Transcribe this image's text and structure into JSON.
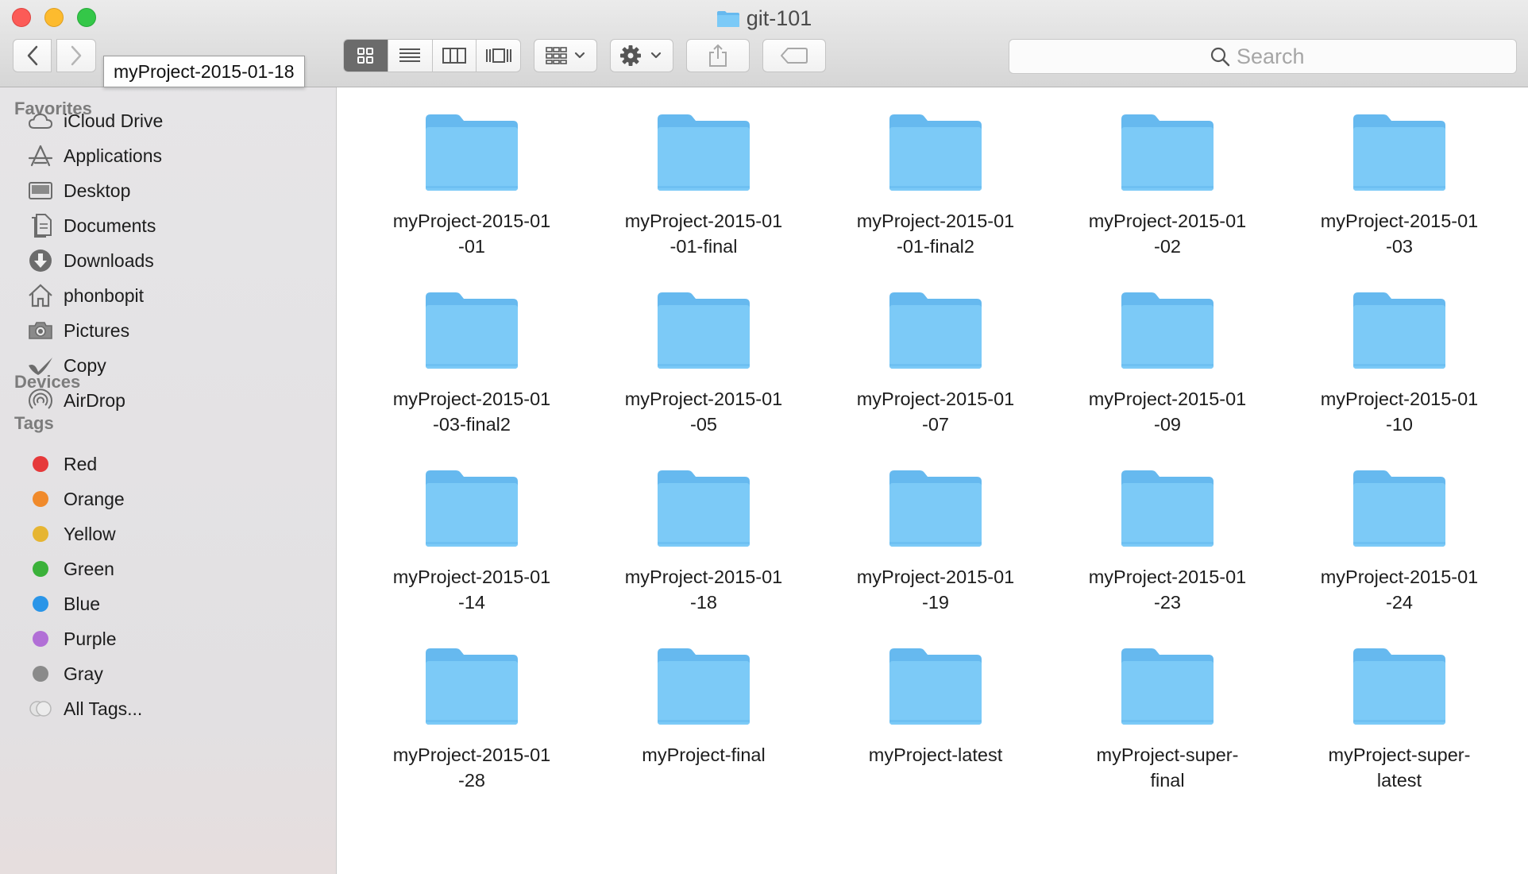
{
  "window": {
    "title": "git-101"
  },
  "toolbar": {
    "tooltip": "myProject-2015-01-18",
    "search_placeholder": "Search"
  },
  "sidebar": {
    "favorites_heading": "Favorites",
    "favorites": [
      {
        "label": "iCloud Drive",
        "icon": "cloud-icon"
      },
      {
        "label": "Applications",
        "icon": "applications-icon"
      },
      {
        "label": "Desktop",
        "icon": "desktop-icon"
      },
      {
        "label": "Documents",
        "icon": "documents-icon"
      },
      {
        "label": "Downloads",
        "icon": "downloads-icon"
      },
      {
        "label": "phonbopit",
        "icon": "home-icon"
      },
      {
        "label": "Pictures",
        "icon": "camera-icon"
      },
      {
        "label": "Copy",
        "icon": "copy-icon"
      },
      {
        "label": "AirDrop",
        "icon": "airdrop-icon"
      }
    ],
    "devices_heading": "Devices",
    "tags_heading": "Tags",
    "tags": [
      {
        "label": "Red",
        "color": "#e6393a"
      },
      {
        "label": "Orange",
        "color": "#f08a2b"
      },
      {
        "label": "Yellow",
        "color": "#e6b532"
      },
      {
        "label": "Green",
        "color": "#3bb13a"
      },
      {
        "label": "Blue",
        "color": "#2a95e8"
      },
      {
        "label": "Purple",
        "color": "#b16fd6"
      },
      {
        "label": "Gray",
        "color": "#8a8a8a"
      },
      {
        "label": "All Tags...",
        "color": "#d8d8d8"
      }
    ]
  },
  "colors": {
    "folder_body": "#7ccaf7",
    "folder_tab": "#66b9ef",
    "active_view": "#6b6b6b"
  },
  "files": [
    "myProject-2015-01\n-01",
    "myProject-2015-01\n-01-final",
    "myProject-2015-01\n-01-final2",
    "myProject-2015-01\n-02",
    "myProject-2015-01\n-03",
    "myProject-2015-01\n-03-final2",
    "myProject-2015-01\n-05",
    "myProject-2015-01\n-07",
    "myProject-2015-01\n-09",
    "myProject-2015-01\n-10",
    "myProject-2015-01\n-14",
    "myProject-2015-01\n-18",
    "myProject-2015-01\n-19",
    "myProject-2015-01\n-23",
    "myProject-2015-01\n-24",
    "myProject-2015-01\n-28",
    "myProject-final",
    "myProject-latest",
    "myProject-super-\nfinal",
    "myProject-super-\nlatest"
  ]
}
